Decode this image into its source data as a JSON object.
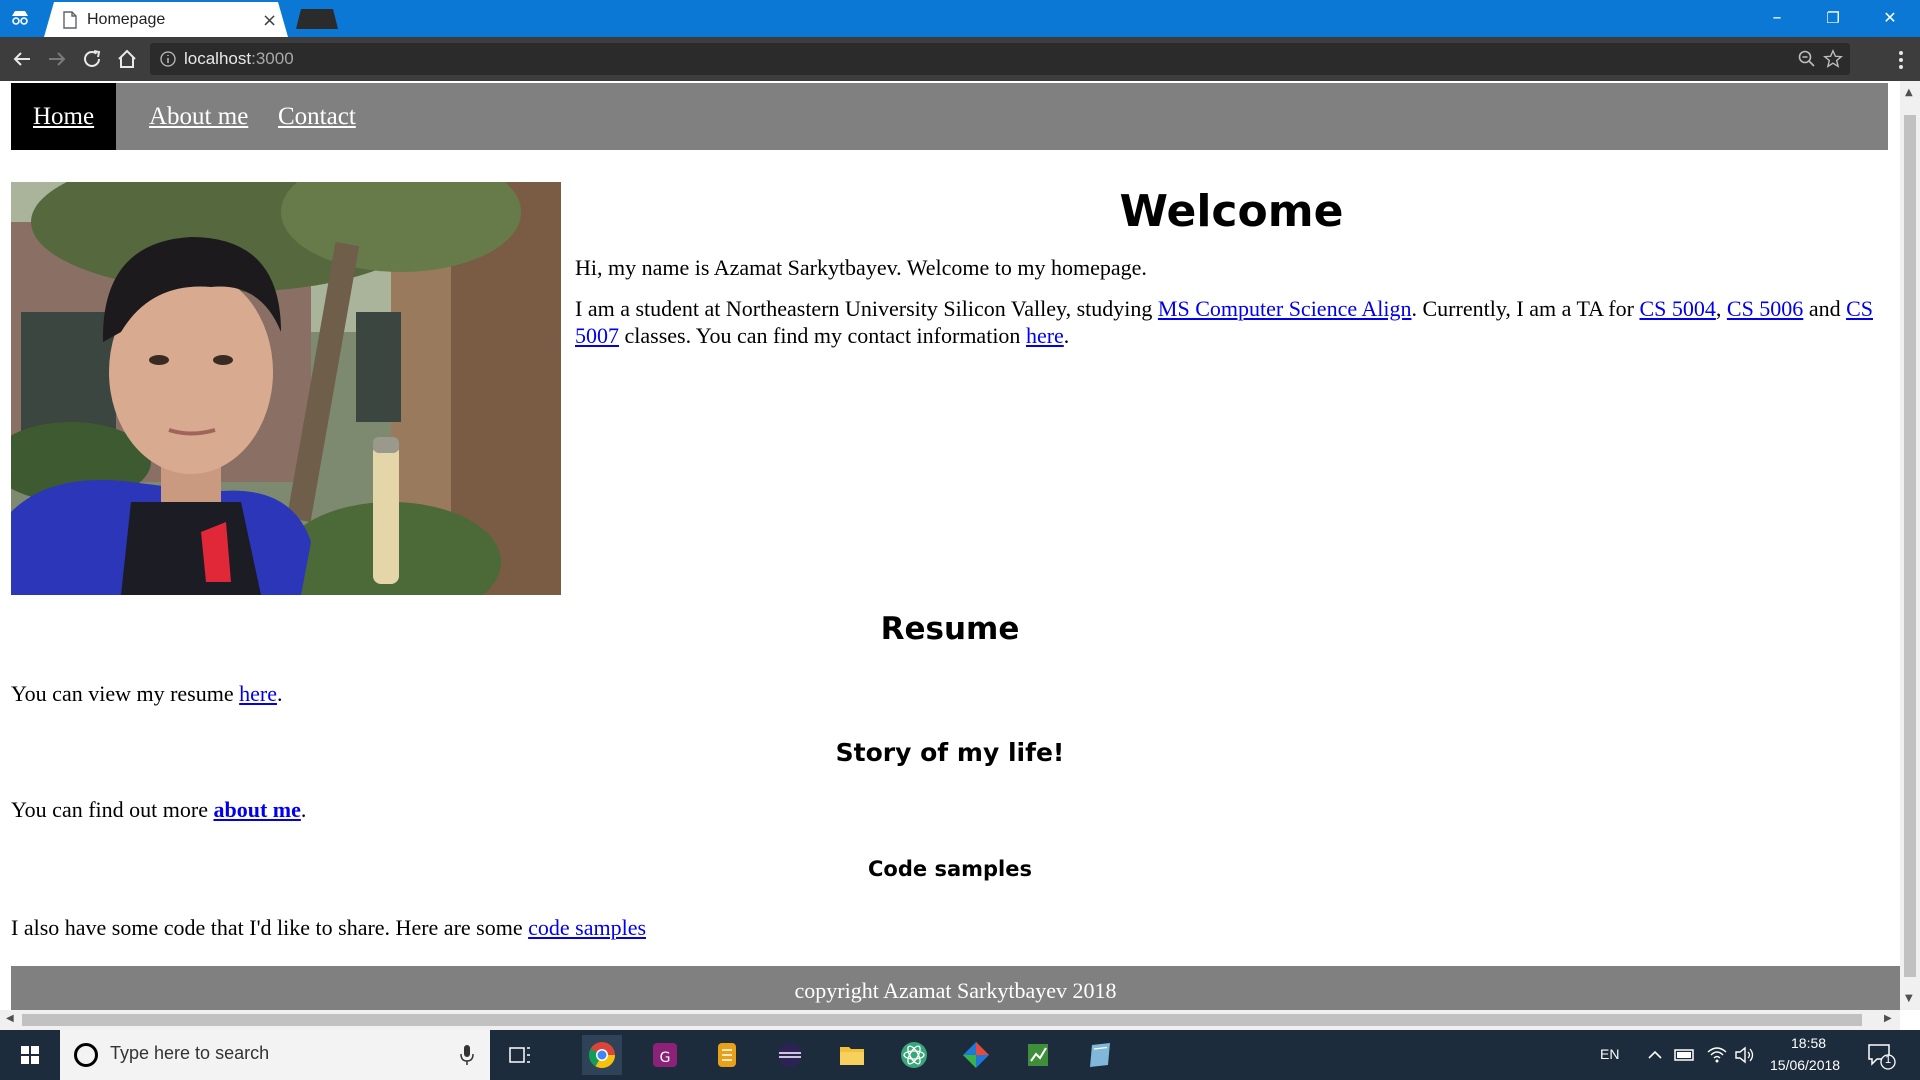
{
  "browser": {
    "tab_title": "Homepage",
    "tab_close": "×",
    "url_host": "localhost",
    "url_port": ":3000",
    "window_controls": {
      "minimize": "–",
      "restore": "❐",
      "close": "✕"
    }
  },
  "site": {
    "nav": [
      "Home",
      "About me",
      "Contact"
    ],
    "welcome_title": "Welcome",
    "intro": "Hi, my name is Azamat Sarkytbayev. Welcome to my homepage.",
    "student_text_1": "I am a student at Northeastern University Silicon Valley, studying ",
    "link_ms_align": "MS Computer Science Align",
    "student_text_2": ". Currently, I am a TA for ",
    "link_cs5004": "CS 5004",
    "comma": ", ",
    "link_cs5006": "CS 5006",
    "and_text": " and ",
    "link_cs5007": "CS 5007",
    "student_text_3": " classes. You can find my contact information ",
    "link_here_contact": "here",
    "period": ".",
    "resume_heading": "Resume",
    "resume_text": "You can view my resume ",
    "resume_link": "here",
    "story_heading": "Story of my life!",
    "story_text": "You can find out more ",
    "story_link": "about me",
    "code_heading": "Code samples",
    "code_text": "I also have some code that I'd like to share. Here are some ",
    "code_link": "code samples",
    "footer": "copyright Azamat Sarkytbayev 2018"
  },
  "taskbar": {
    "search_placeholder": "Type here to search",
    "language": "EN",
    "time": "18:58",
    "date": "15/06/2018",
    "notification_count": "1"
  },
  "colors": {
    "titlebar": "#0a78d4",
    "toolbar": "#3d3d3d",
    "site_nav": "#808080",
    "link": "#0000ee",
    "taskbar": "#1c2c3c"
  }
}
